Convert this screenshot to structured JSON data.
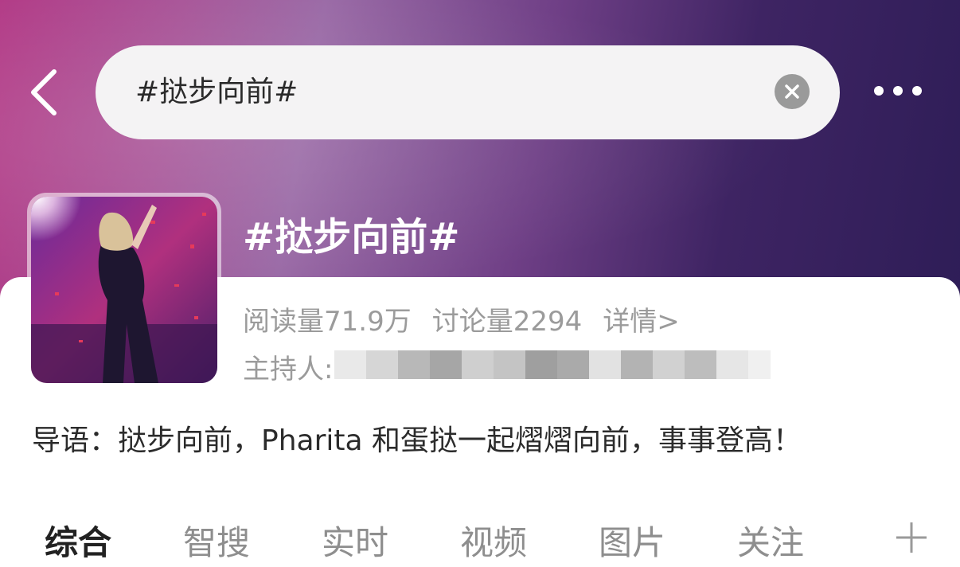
{
  "search": {
    "query": "#挞步向前#"
  },
  "topic": {
    "title": "#挞步向前#",
    "reads": "阅读量71.9万",
    "discussions": "讨论量2294",
    "detail_link": "详情>",
    "host_label": "主持人:"
  },
  "intro": "导语：挞步向前，Pharita 和蛋挞一起熠熠向前，事事登高！",
  "tabs": [
    "综合",
    "智搜",
    "实时",
    "视频",
    "图片",
    "关注"
  ],
  "colors": {
    "header_gradient_start": "#b23a86",
    "header_gradient_end": "#2e1d57",
    "active_tab": "#222222",
    "inactive_tab": "#8e8e8e",
    "meta_text": "#9b9b9b"
  },
  "icons": {
    "back": "chevron-left-icon",
    "clear": "clear-circle-icon",
    "more": "more-dots-icon",
    "add_tab": "plus-icon"
  }
}
